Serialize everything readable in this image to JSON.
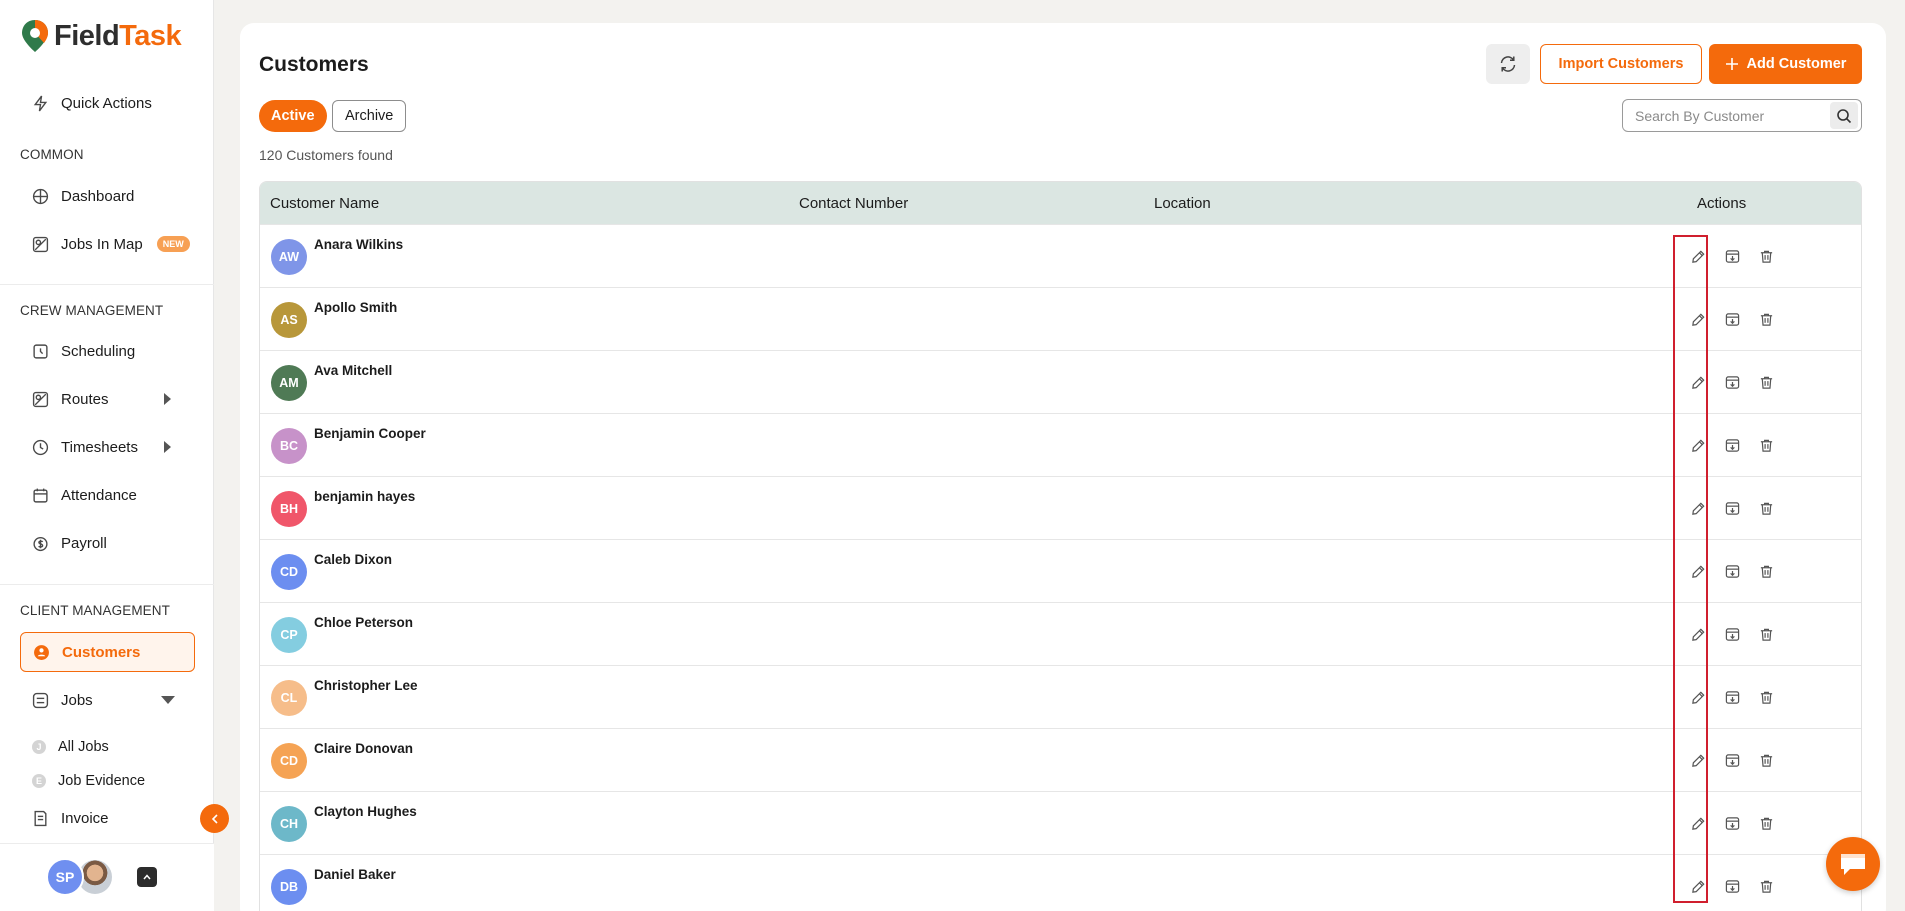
{
  "app": {
    "brand_first": "Field",
    "brand_second": "Task",
    "colors": {
      "accent": "#f46a0c",
      "table_header": "#dbe6e2",
      "highlight": "#d01f2e"
    }
  },
  "sidebar": {
    "quick_actions": "Quick Actions",
    "section_common": "COMMON",
    "dashboard": "Dashboard",
    "jobs_in_map": "Jobs In Map",
    "new_badge": "NEW",
    "section_crew": "CREW MANAGEMENT",
    "scheduling": "Scheduling",
    "routes": "Routes",
    "timesheets": "Timesheets",
    "attendance": "Attendance",
    "payroll": "Payroll",
    "section_client": "CLIENT MANAGEMENT",
    "customers": "Customers",
    "jobs": "Jobs",
    "all_jobs": "All Jobs",
    "all_jobs_letter": "J",
    "job_evidence": "Job Evidence",
    "job_evidence_letter": "E",
    "invoice": "Invoice",
    "user_initials": "SP"
  },
  "main": {
    "title": "Customers",
    "tab_active": "Active",
    "tab_archive": "Archive",
    "count_text": "120 Customers found",
    "import_label": "Import Customers",
    "add_label": "Add Customer",
    "search_placeholder": "Search By Customer",
    "search_value": ""
  },
  "table": {
    "headers": {
      "name": "Customer Name",
      "contact": "Contact Number",
      "location": "Location",
      "actions": "Actions"
    },
    "rows": [
      {
        "initials": "AW",
        "name": "Anara Wilkins",
        "color": "#7f95e8"
      },
      {
        "initials": "AS",
        "name": "Apollo Smith",
        "color": "#b8973a"
      },
      {
        "initials": "AM",
        "name": "Ava Mitchell",
        "color": "#4f7a55"
      },
      {
        "initials": "BC",
        "name": "Benjamin Cooper",
        "color": "#c792c9"
      },
      {
        "initials": "BH",
        "name": "benjamin hayes",
        "color": "#f0566a"
      },
      {
        "initials": "CD",
        "name": "Caleb Dixon",
        "color": "#6c8ef0"
      },
      {
        "initials": "CP",
        "name": "Chloe Peterson",
        "color": "#84cde0"
      },
      {
        "initials": "CL",
        "name": "Christopher Lee",
        "color": "#f6bd8a"
      },
      {
        "initials": "CD",
        "name": "Claire Donovan",
        "color": "#f5a354"
      },
      {
        "initials": "CH",
        "name": "Clayton Hughes",
        "color": "#6db8c9"
      },
      {
        "initials": "DB",
        "name": "Daniel Baker",
        "color": "#6c8ef0"
      }
    ]
  }
}
